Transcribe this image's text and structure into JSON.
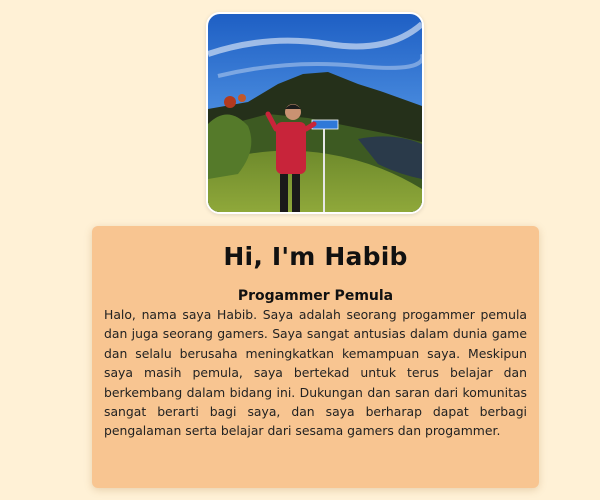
{
  "profile": {
    "photo_alt": "Habib standing in front of a mountain",
    "heading": "Hi, I'm Habib",
    "role": "Progammer Pemula",
    "bio": "Halo, nama saya Habib. Saya adalah seorang progammer pemula dan juga seorang gamers. Saya sangat antusias dalam dunia game dan selalu berusaha meningkatkan kemampuan saya. Meskipun saya masih pemula, saya bertekad untuk terus belajar dan berkembang dalam bidang ini. Dukungan dan saran dari komunitas sangat berarti bagi saya, dan saya berharap dapat berbagi pengalaman serta belajar dari sesama gamers dan progammer."
  },
  "colors": {
    "page_background": "#fff1d6",
    "card_background": "#f8c591"
  }
}
